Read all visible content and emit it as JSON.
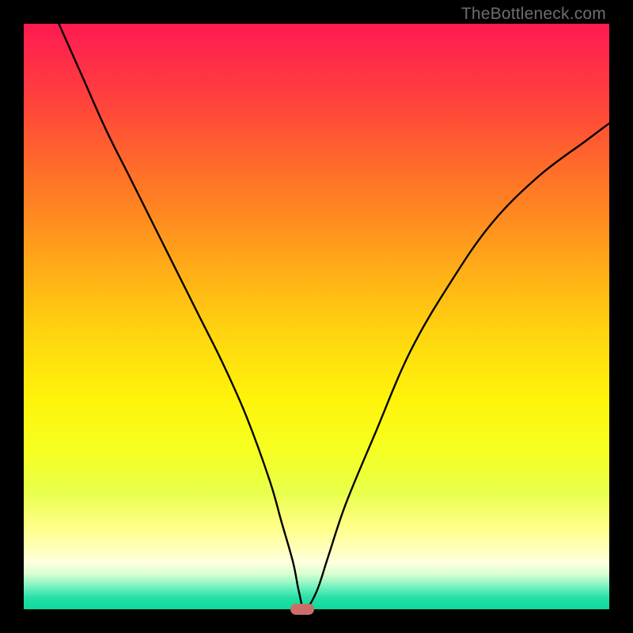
{
  "watermark": "TheBottleneck.com",
  "chart_data": {
    "type": "line",
    "title": "",
    "xlabel": "",
    "ylabel": "",
    "xlim": [
      0,
      100
    ],
    "ylim": [
      0,
      100
    ],
    "series": [
      {
        "name": "bottleneck-curve",
        "x": [
          6,
          10,
          14,
          18,
          22,
          26,
          30,
          34,
          38,
          42,
          44,
          46,
          47,
          48,
          50,
          52,
          55,
          60,
          66,
          73,
          80,
          88,
          96,
          100
        ],
        "values": [
          100,
          91,
          82,
          74,
          66,
          58,
          50,
          42,
          33,
          22,
          15,
          8,
          3,
          0,
          3,
          9,
          18,
          30,
          44,
          56,
          66,
          74,
          80,
          83
        ]
      }
    ],
    "marker": {
      "x": 47.5,
      "y": 0
    },
    "background_gradient": {
      "top": "#ff1a52",
      "mid": "#fff30a",
      "bottom": "#0fd89c"
    }
  }
}
